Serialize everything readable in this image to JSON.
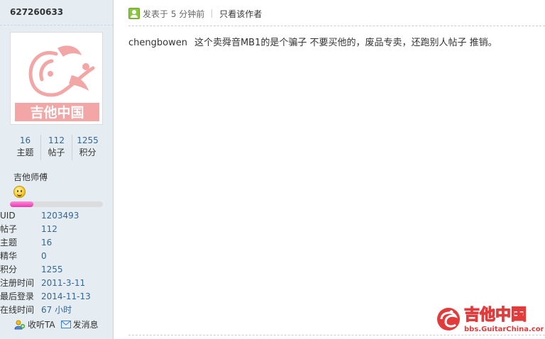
{
  "author": {
    "username": "627260633",
    "avatar_text": "吉他中国",
    "stats": [
      {
        "value": "16",
        "label": "主题"
      },
      {
        "value": "112",
        "label": "帖子"
      },
      {
        "value": "1255",
        "label": "积分"
      }
    ],
    "rank_title": "吉他师傅",
    "rank_progress_percent": 25,
    "info": [
      {
        "key": "UID",
        "value": "1203493"
      },
      {
        "key": "帖子",
        "value": "112"
      },
      {
        "key": "主题",
        "value": "16"
      },
      {
        "key": "精华",
        "value": "0"
      },
      {
        "key": "积分",
        "value": "1255"
      },
      {
        "key": "注册时间",
        "value": "2011-3-11"
      },
      {
        "key": "最后登录",
        "value": "2014-11-13"
      },
      {
        "key": "在线时间",
        "value": "67 小时"
      }
    ],
    "actions": {
      "follow_label": "收听TA",
      "message_label": "发消息"
    }
  },
  "post": {
    "posted_time": "发表于 5 分钟前",
    "author_only_label": "只看该作者",
    "mention": "chengbowen",
    "body": "这个卖舜音MB1的是个骗子   不要买他的，废品专卖，还跑别人帖子 推销。"
  },
  "watermark": {
    "title": "吉他中国",
    "url": "bbs.GuitarChina.com"
  },
  "colors": {
    "sidebar_bg": "#e5edf2",
    "link_blue": "#336699",
    "logo_red": "#e23b3b",
    "progress_pink": "#e23bb0"
  }
}
